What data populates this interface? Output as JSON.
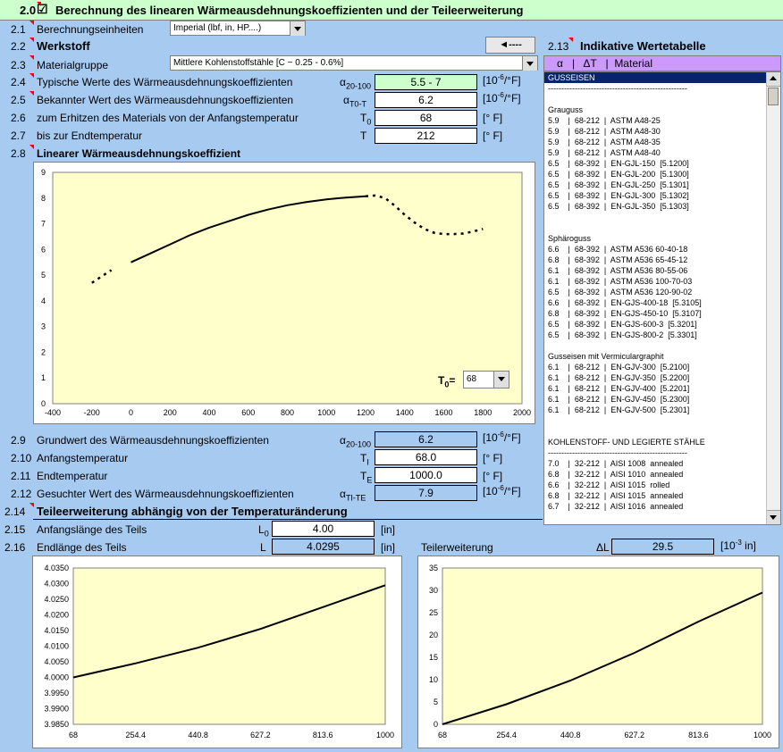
{
  "header": {
    "num": "2.0",
    "checkbox": "☑",
    "title": "Berechnung des linearen Wärmeausdehnungskoeffizienten und der Teileerweiterung"
  },
  "r21": {
    "num": "2.1",
    "label": "Berechnungseinheiten",
    "value": "Imperial (lbf, in, HP....)"
  },
  "r22": {
    "num": "2.2",
    "label": "Werkstoff",
    "btn": "◄----"
  },
  "r23": {
    "num": "2.3",
    "label": "Materialgruppe",
    "value": "Mittlere Kohlenstoffstähle   [C ~ 0.25 - 0.6%]"
  },
  "r24": {
    "num": "2.4",
    "label": "Typische Werte des Wärmeausdehnungskoeffizienten",
    "sym": "α",
    "sub": "20-100",
    "value": "5.5 - 7",
    "unit": "[10",
    "unitexp": "-6",
    "unitend": "/°F]"
  },
  "r25": {
    "num": "2.5",
    "label": "Bekannter Wert des Wärmeausdehnungskoeffizienten",
    "sym": "α",
    "sub": "T0-T",
    "value": "6.2",
    "unit": "[10",
    "unitexp": "-6",
    "unitend": "/°F]"
  },
  "r26": {
    "num": "2.6",
    "label": "zum Erhitzen des Materials von der Anfangstemperatur",
    "sym": "T",
    "sub": "0",
    "value": "68",
    "unit": "[° F]"
  },
  "r27": {
    "num": "2.7",
    "label": "bis zur Endtemperatur",
    "sym": "T",
    "value": "212",
    "unit": "[° F]"
  },
  "r28": {
    "num": "2.8",
    "label": "Linearer Wärmeausdehnungskoeffizient",
    "t0label": "T",
    "t0sub": "0",
    "t0eq": "=",
    "t0value": "68"
  },
  "r29": {
    "num": "2.9",
    "label": "Grundwert des Wärmeausdehnungskoeffizienten",
    "sym": "α",
    "sub": "20-100",
    "value": "6.2",
    "unit": "[10",
    "unitexp": "-6",
    "unitend": "/°F]"
  },
  "r210": {
    "num": "2.10",
    "label": "Anfangstemperatur",
    "sym": "T",
    "sub": "I",
    "value": "68.0",
    "unit": "[° F]"
  },
  "r211": {
    "num": "2.11",
    "label": "Endtemperatur",
    "sym": "T",
    "sub": "E",
    "value": "1000.0",
    "unit": "[° F]"
  },
  "r212": {
    "num": "2.12",
    "label": "Gesuchter Wert des Wärmeausdehnungskoeffizienten",
    "sym": "α",
    "sub": "TI-TE",
    "value": "7.9",
    "unit": "[10",
    "unitexp": "-6",
    "unitend": "/°F]"
  },
  "r214": {
    "num": "2.14",
    "label": "Teileerweiterung abhängig von der Temperaturänderung"
  },
  "r215": {
    "num": "2.15",
    "label": "Anfangslänge des Teils",
    "sym": "L",
    "sub": "0",
    "value": "4.00",
    "unit": "[in]"
  },
  "r216": {
    "num": "2.16",
    "label": "Endlänge des Teils",
    "sym": "L",
    "value": "4.0295",
    "unit": "[in]",
    "label2": "Teilerweiterung",
    "sym2": "ΔL",
    "value2": "29.5",
    "unit2": "[10",
    "unit2exp": "-3",
    "unit2end": " in]"
  },
  "table": {
    "num": "2.13",
    "title": "Indikative Wertetabelle",
    "header": "α   |   ΔT   |  Material",
    "rows": [
      "GUSSEISEN",
      "----------------------------------------------------",
      "",
      "Grauguss",
      "5.9    |  68-212  |  ASTM A48-25",
      "5.9    |  68-212  |  ASTM A48-30",
      "5.9    |  68-212  |  ASTM A48-35",
      "5.9    |  68-212  |  ASTM A48-40",
      "6.5    |  68-392  |  EN-GJL-150  [5.1200]",
      "6.5    |  68-392  |  EN-GJL-200  [5.1300]",
      "6.5    |  68-392  |  EN-GJL-250  [5.1301]",
      "6.5    |  68-392  |  EN-GJL-300  [5.1302]",
      "6.5    |  68-392  |  EN-GJL-350  [5.1303]",
      "",
      "",
      "Sphäroguss",
      "6.6    |  68-392  |  ASTM A536 60-40-18",
      "6.8    |  68-392  |  ASTM A536 65-45-12",
      "6.1    |  68-392  |  ASTM A536 80-55-06",
      "6.1    |  68-392  |  ASTM A536 100-70-03",
      "6.5    |  68-392  |  ASTM A536 120-90-02",
      "6.6    |  68-392  |  EN-GJS-400-18  [5.3105]",
      "6.8    |  68-392  |  EN-GJS-450-10  [5.3107]",
      "6.5    |  68-392  |  EN-GJS-600-3  [5.3201]",
      "6.5    |  68-392  |  EN-GJS-800-2  [5.3301]",
      "",
      "Gusseisen mit Vermiculargraphit",
      "6.1    |  68-212  |  EN-GJV-300  [5.2100]",
      "6.1    |  68-212  |  EN-GJV-350  [5.2200]",
      "6.1    |  68-212  |  EN-GJV-400  [5.2201]",
      "6.1    |  68-212  |  EN-GJV-450  [5.2300]",
      "6.1    |  68-212  |  EN-GJV-500  [5.2301]",
      "",
      "",
      "KOHLENSTOFF- UND LEGIERTE STÄHLE",
      "----------------------------------------------------",
      "7.0    |  32-212  |  AISI 1008  annealed",
      "6.8    |  32-212  |  AISI 1010  annealed",
      "6.6    |  32-212  |  AISI 1015  rolled",
      "6.8    |  32-212  |  AISI 1015  annealed",
      "6.7    |  32-212  |  AISI 1016  annealed"
    ]
  },
  "colors": {
    "bg": "#A6CAF0",
    "plot": "#FFFFCC",
    "header": "#CCFFCC",
    "tablehead": "#CC99FF",
    "highlight": "#0A246A"
  },
  "chart_data": [
    {
      "type": "line",
      "xlim": [
        -400,
        2000
      ],
      "ylim": [
        0,
        9
      ],
      "xticks": [
        "-400",
        "-200",
        "0",
        "200",
        "400",
        "600",
        "800",
        "1000",
        "1200",
        "1400",
        "1600",
        "1800",
        "2000"
      ],
      "yticks": [
        "0",
        "1",
        "2",
        "3",
        "4",
        "5",
        "6",
        "7",
        "8",
        "9"
      ],
      "series_dotted_1": {
        "x": [
          -200,
          -150,
          -100
        ],
        "y": [
          4.7,
          4.95,
          5.2
        ]
      },
      "series_solid": {
        "x": [
          0,
          100,
          200,
          300,
          400,
          500,
          600,
          700,
          800,
          900,
          1000,
          1100,
          1200
        ],
        "y": [
          5.5,
          5.85,
          6.2,
          6.55,
          6.85,
          7.1,
          7.35,
          7.55,
          7.72,
          7.85,
          7.95,
          8.02,
          8.07
        ]
      },
      "series_dotted_2": {
        "x": [
          1200,
          1250,
          1300,
          1350,
          1400,
          1450,
          1500,
          1550,
          1600,
          1650,
          1700,
          1750,
          1800
        ],
        "y": [
          8.07,
          8.1,
          8.0,
          7.7,
          7.35,
          7.05,
          6.8,
          6.65,
          6.6,
          6.6,
          6.62,
          6.7,
          6.8
        ]
      }
    },
    {
      "type": "line",
      "ylim": [
        3.985,
        4.035
      ],
      "xticks": [
        "68",
        "254.4",
        "440.8",
        "627.2",
        "813.6",
        "1000"
      ],
      "yticks": [
        "3.9850",
        "3.9900",
        "3.9950",
        "4.0000",
        "4.0050",
        "4.0100",
        "4.0150",
        "4.0200",
        "4.0250",
        "4.0300",
        "4.0350"
      ],
      "x": [
        68,
        254.4,
        440.8,
        627.2,
        813.6,
        1000
      ],
      "y": [
        4.0,
        4.0045,
        4.0095,
        4.0155,
        4.0225,
        4.0295
      ]
    },
    {
      "type": "line",
      "ylim": [
        0,
        35
      ],
      "xticks": [
        "68",
        "254.4",
        "440.8",
        "627.2",
        "813.6",
        "1000"
      ],
      "yticks": [
        "0",
        "5",
        "10",
        "15",
        "20",
        "25",
        "30",
        "35"
      ],
      "x": [
        68,
        254.4,
        440.8,
        627.2,
        813.6,
        1000
      ],
      "y": [
        0,
        4.5,
        9.8,
        16.0,
        23.0,
        29.5
      ]
    }
  ]
}
